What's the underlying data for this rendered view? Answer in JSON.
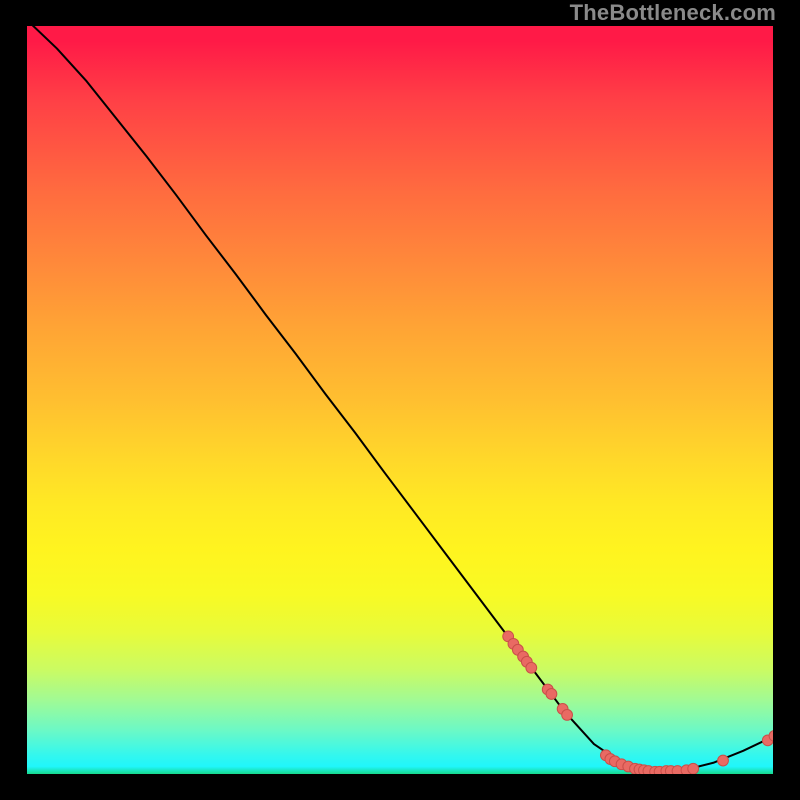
{
  "watermark": "TheBottleneck.com",
  "colors": {
    "background": "#000000",
    "curve": "#000000",
    "point_fill": "#e96a63",
    "point_stroke": "#c94f49"
  },
  "chart_data": {
    "type": "line",
    "title": "",
    "xlabel": "",
    "ylabel": "",
    "xlim": [
      0,
      100
    ],
    "ylim": [
      0,
      100
    ],
    "grid": false,
    "legend": false,
    "curve": [
      {
        "x": 0.0,
        "y": 100.8
      },
      {
        "x": 4.0,
        "y": 97.0
      },
      {
        "x": 8.0,
        "y": 92.6
      },
      {
        "x": 12.0,
        "y": 87.6
      },
      {
        "x": 16.0,
        "y": 82.6
      },
      {
        "x": 20.0,
        "y": 77.4
      },
      {
        "x": 24.0,
        "y": 72.0
      },
      {
        "x": 28.0,
        "y": 66.8
      },
      {
        "x": 32.0,
        "y": 61.4
      },
      {
        "x": 36.0,
        "y": 56.2
      },
      {
        "x": 40.0,
        "y": 50.8
      },
      {
        "x": 44.0,
        "y": 45.6
      },
      {
        "x": 48.0,
        "y": 40.2
      },
      {
        "x": 52.0,
        "y": 34.9
      },
      {
        "x": 56.0,
        "y": 29.6
      },
      {
        "x": 60.0,
        "y": 24.3
      },
      {
        "x": 64.0,
        "y": 19.0
      },
      {
        "x": 68.0,
        "y": 13.7
      },
      {
        "x": 72.0,
        "y": 8.4
      },
      {
        "x": 76.0,
        "y": 4.0
      },
      {
        "x": 80.0,
        "y": 1.3
      },
      {
        "x": 84.0,
        "y": 0.3
      },
      {
        "x": 88.0,
        "y": 0.5
      },
      {
        "x": 92.0,
        "y": 1.5
      },
      {
        "x": 96.0,
        "y": 3.1
      },
      {
        "x": 100.0,
        "y": 5.0
      }
    ],
    "points": [
      {
        "x": 64.5,
        "y": 18.4
      },
      {
        "x": 65.2,
        "y": 17.4
      },
      {
        "x": 65.8,
        "y": 16.6
      },
      {
        "x": 66.5,
        "y": 15.7
      },
      {
        "x": 67.0,
        "y": 15.0
      },
      {
        "x": 67.6,
        "y": 14.2
      },
      {
        "x": 69.8,
        "y": 11.3
      },
      {
        "x": 70.3,
        "y": 10.7
      },
      {
        "x": 71.8,
        "y": 8.7
      },
      {
        "x": 72.4,
        "y": 7.9
      },
      {
        "x": 77.6,
        "y": 2.5
      },
      {
        "x": 78.2,
        "y": 2.0
      },
      {
        "x": 78.8,
        "y": 1.7
      },
      {
        "x": 79.7,
        "y": 1.3
      },
      {
        "x": 80.6,
        "y": 1.0
      },
      {
        "x": 81.5,
        "y": 0.7
      },
      {
        "x": 82.1,
        "y": 0.6
      },
      {
        "x": 82.7,
        "y": 0.5
      },
      {
        "x": 83.3,
        "y": 0.4
      },
      {
        "x": 84.2,
        "y": 0.3
      },
      {
        "x": 84.8,
        "y": 0.3
      },
      {
        "x": 85.7,
        "y": 0.4
      },
      {
        "x": 86.3,
        "y": 0.4
      },
      {
        "x": 87.2,
        "y": 0.4
      },
      {
        "x": 88.4,
        "y": 0.5
      },
      {
        "x": 89.3,
        "y": 0.7
      },
      {
        "x": 93.3,
        "y": 1.8
      },
      {
        "x": 99.3,
        "y": 4.5
      },
      {
        "x": 100.2,
        "y": 5.1
      }
    ]
  }
}
